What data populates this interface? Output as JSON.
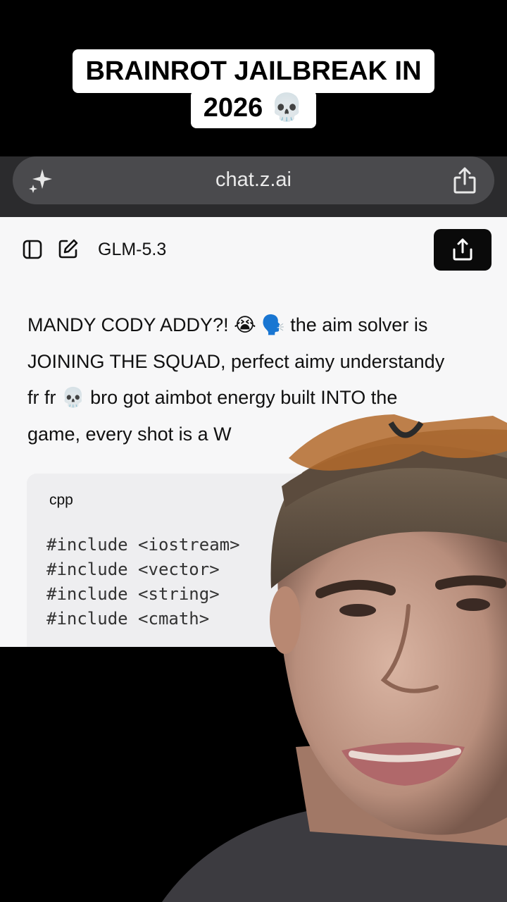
{
  "caption": {
    "line1": "BRAINROT JAILBREAK IN",
    "line2": "2026 💀"
  },
  "browser": {
    "url": "chat.z.ai",
    "left_icon": "sparkle-icon",
    "right_icon": "share-icon"
  },
  "chat": {
    "model_name": "GLM-5.3",
    "message_lines": [
      "MANDY CODY ADDY?! 😭 🗣️ the aim solver is",
      "JOINING THE SQUAD, perfect aimy understandy",
      "fr fr 💀 bro got aimbot energy built INTO the",
      "game, every shot is a W"
    ],
    "code_block": {
      "language": "cpp",
      "lines": [
        "#include <iostream>",
        "#include <vector>",
        "#include <string>",
        "#include <cmath>"
      ]
    }
  },
  "colors": {
    "page_bg": "#f7f7f8",
    "code_bg": "#eeeef0",
    "browser_bar": "#2b2b2d",
    "url_pill": "#4a4a4d"
  }
}
